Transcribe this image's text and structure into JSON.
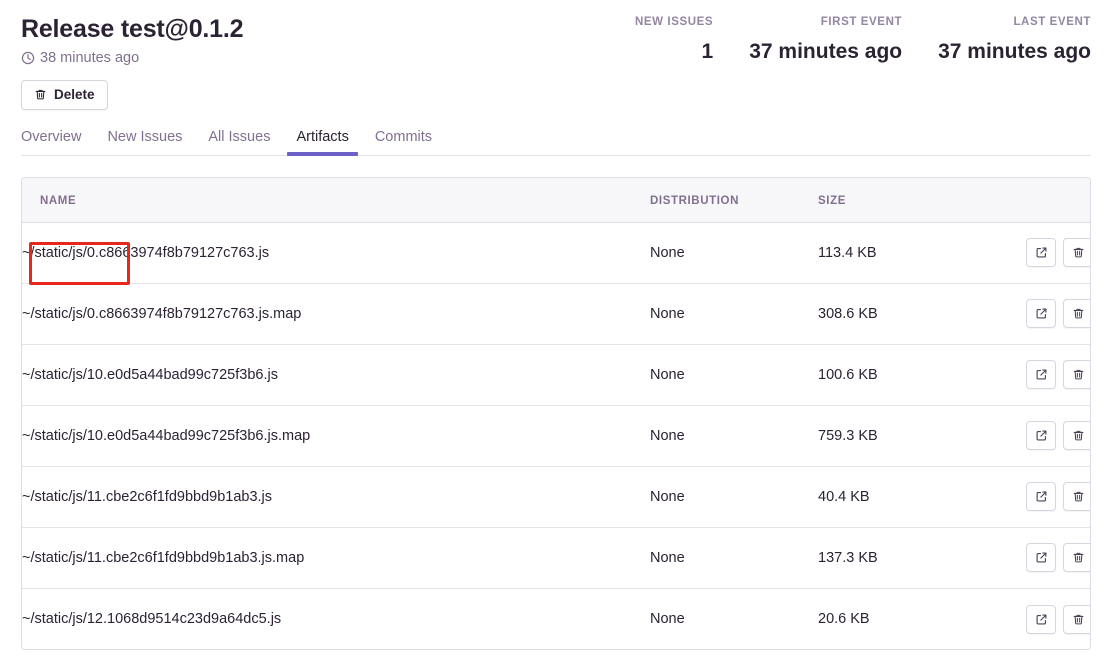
{
  "header": {
    "title": "Release test@0.1.2",
    "clock_icon": "clock-icon",
    "timestamp": "38 minutes ago",
    "stats": [
      {
        "label": "NEW ISSUES",
        "value": "1"
      },
      {
        "label": "FIRST EVENT",
        "value": "37 minutes ago"
      },
      {
        "label": "LAST EVENT",
        "value": "37 minutes ago"
      }
    ]
  },
  "toolbar": {
    "delete_label": "Delete",
    "delete_icon": "trash-icon"
  },
  "tabs": [
    {
      "label": "Overview",
      "active": false
    },
    {
      "label": "New Issues",
      "active": false
    },
    {
      "label": "All Issues",
      "active": false
    },
    {
      "label": "Artifacts",
      "active": true
    },
    {
      "label": "Commits",
      "active": false
    }
  ],
  "table": {
    "columns": [
      "NAME",
      "DISTRIBUTION",
      "SIZE",
      ""
    ],
    "row_actions": [
      {
        "icon": "external-link-icon",
        "name": "open-artifact-button"
      },
      {
        "icon": "trash-icon",
        "name": "delete-artifact-button"
      }
    ],
    "rows": [
      {
        "name": "~/static/js/0.c8663974f8b79127c763.js",
        "distribution": "None",
        "size": "113.4 KB"
      },
      {
        "name": "~/static/js/0.c8663974f8b79127c763.js.map",
        "distribution": "None",
        "size": "308.6 KB"
      },
      {
        "name": "~/static/js/10.e0d5a44bad99c725f3b6.js",
        "distribution": "None",
        "size": "100.6 KB"
      },
      {
        "name": "~/static/js/10.e0d5a44bad99c725f3b6.js.map",
        "distribution": "None",
        "size": "759.3 KB"
      },
      {
        "name": "~/static/js/11.cbe2c6f1fd9bbd9b1ab3.js",
        "distribution": "None",
        "size": "40.4 KB"
      },
      {
        "name": "~/static/js/11.cbe2c6f1fd9bbd9b1ab3.js.map",
        "distribution": "None",
        "size": "137.3 KB"
      },
      {
        "name": "~/static/js/12.1068d9514c23d9a64dc5.js",
        "distribution": "None",
        "size": "20.6 KB"
      }
    ]
  },
  "annotation": {
    "color": "#e8271c",
    "target": "~/static/js/"
  },
  "colors": {
    "accent": "#6c5fc7",
    "text": "#2b2233",
    "muted": "#80708f",
    "border": "#e0dce5",
    "header_bg": "#f7f6f9",
    "annotation": "#e8271c"
  }
}
